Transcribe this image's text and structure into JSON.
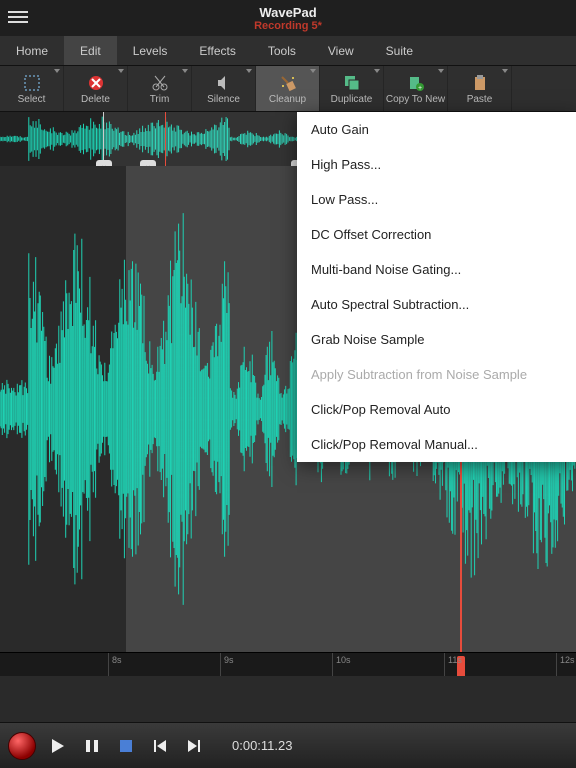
{
  "app": {
    "title": "WavePad",
    "document": "Recording 5*"
  },
  "tabs": [
    "Home",
    "Edit",
    "Levels",
    "Effects",
    "Tools",
    "View",
    "Suite"
  ],
  "tabs_active": 1,
  "tools": [
    {
      "label": "Select",
      "icon": "select"
    },
    {
      "label": "Delete",
      "icon": "delete"
    },
    {
      "label": "Trim",
      "icon": "trim"
    },
    {
      "label": "Silence",
      "icon": "silence"
    },
    {
      "label": "Cleanup",
      "icon": "cleanup",
      "active": true
    },
    {
      "label": "Duplicate",
      "icon": "duplicate"
    },
    {
      "label": "Copy To New",
      "icon": "copynew"
    },
    {
      "label": "Paste",
      "icon": "paste"
    }
  ],
  "cleanup_menu": [
    {
      "label": "Auto Gain"
    },
    {
      "label": "High Pass..."
    },
    {
      "label": "Low Pass..."
    },
    {
      "label": "DC Offset Correction"
    },
    {
      "label": "Multi-band Noise Gating..."
    },
    {
      "label": "Auto Spectral Subtraction..."
    },
    {
      "label": "Grab Noise Sample"
    },
    {
      "label": "Apply Subtraction from Noise Sample",
      "disabled": true
    },
    {
      "label": "Click/Pop Removal Auto"
    },
    {
      "label": "Click/Pop Removal Manual..."
    }
  ],
  "ruler": [
    "8s",
    "9s",
    "10s",
    "11s",
    "12s"
  ],
  "transport": {
    "timecode": "0:00:11.23"
  },
  "colors": {
    "wave": "#1fd1b3",
    "accent": "#e74c3c"
  }
}
